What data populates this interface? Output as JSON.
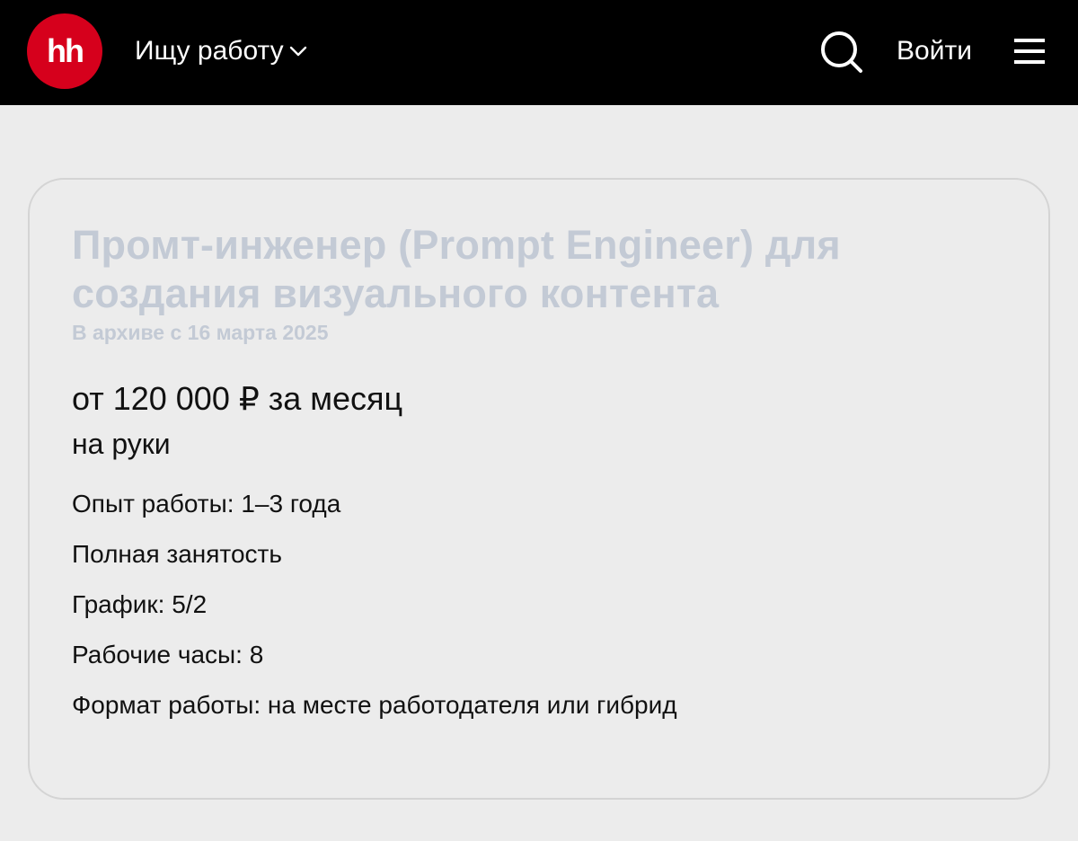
{
  "header": {
    "logo_text": "hh",
    "job_search_label": "Ищу работу",
    "login_label": "Войти",
    "icons": {
      "search": "search-icon",
      "menu": "hamburger-menu-icon",
      "dropdown": "chevron-down-icon"
    }
  },
  "vacancy": {
    "title": "Промт-инженер (Prompt Engineer) для создания визуального контента",
    "archive_note": "В архиве с 16 марта 2025",
    "salary": "от 120 000 ₽ за месяц",
    "salary_note": "на руки",
    "details": [
      "Опыт работы: 1–3 года",
      "Полная занятость",
      "График: 5/2",
      "Рабочие часы: 8",
      "Формат работы: на месте работодателя или гибрид"
    ]
  },
  "colors": {
    "header_bg": "#000000",
    "brand_red": "#d6001c",
    "page_bg": "#ececec",
    "archived_text": "#c3cad5",
    "card_border": "#d4d4d4",
    "text": "#111111"
  }
}
